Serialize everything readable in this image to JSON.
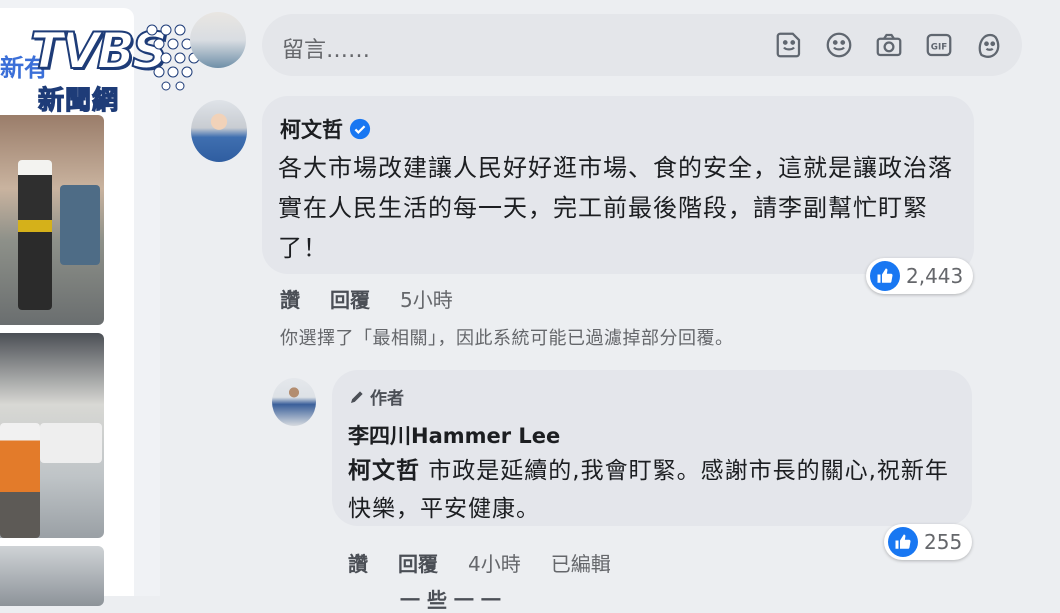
{
  "logo": {
    "word": "TVBS",
    "sub": "新聞網"
  },
  "sidebar": {
    "partial_text": "新有"
  },
  "comment_input": {
    "placeholder": "留言……",
    "icons": [
      "sticker-icon",
      "emoji-icon",
      "camera-icon",
      "gif-icon",
      "avatar-sticker-icon"
    ],
    "gif_label": "GIF"
  },
  "comment": {
    "author": "柯文哲",
    "text": "各大市場改建讓人民好好逛市場、食的安全，這就是讓政治落實在人民生活的每一天，完工前最後階段，請李副幫忙盯緊了！",
    "reaction_count": "2,443",
    "like_label": "讚",
    "reply_label": "回覆",
    "time": "5小時"
  },
  "filter_notice": "你選擇了「最相關」，因此系統可能已過濾掉部分回覆。",
  "reply": {
    "tag": "作者",
    "author": "李四川Hammer Lee",
    "mention": "柯文哲",
    "text": " 市政是延續的,我會盯緊。感謝市長的關心,祝新年快樂，平安健康。",
    "reaction_count": "255",
    "like_label": "讚",
    "reply_label": "回覆",
    "time": "4小時",
    "edited": "已編輯"
  },
  "cut_text": "一 些 一 一"
}
